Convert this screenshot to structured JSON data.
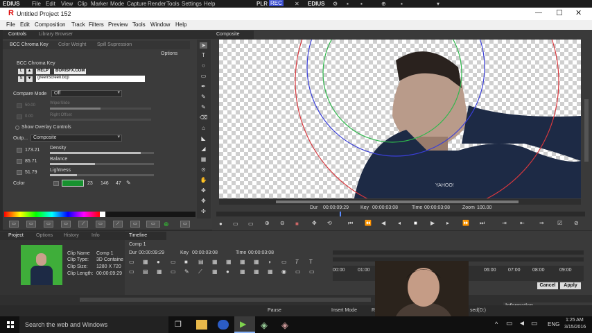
{
  "edius_bar": {
    "logo": "EDIUS",
    "menus": [
      "File",
      "Edit",
      "View",
      "Clip",
      "Marker",
      "Mode",
      "Capture",
      "Render",
      "Tools",
      "Settings",
      "Help"
    ],
    "right_logo": "EDIUS",
    "plr": "PLR",
    "rec": "REC"
  },
  "window": {
    "icon": "R",
    "title": "Untitled Project 152"
  },
  "menu": [
    "File",
    "Edit",
    "Composition",
    "Track",
    "Filters",
    "Preview",
    "Tools",
    "Window",
    "Help"
  ],
  "left_panel": {
    "tabs": [
      "Controls",
      "Library Browser"
    ],
    "subtabs": [
      "BCC Chroma Key",
      "Color Weight",
      "Spill Supression"
    ],
    "options_label": "Options",
    "effect_name": "BCC Chroma Key",
    "help_badge": "HELP",
    "borisfx_badge": "BORISFX.COM",
    "preset_file": "greenScreen.bcp",
    "compare_mode": {
      "label": "Compare Mode",
      "value": "Off"
    },
    "wipe": {
      "value": "50.00",
      "label": "Wipe/Slide",
      "fraction": 0.5
    },
    "right_offset": {
      "value": "0.00",
      "label": "Right Offset",
      "fraction": 0
    },
    "show_overlay": "Show Overlay Controls",
    "output": {
      "label": "Outp...",
      "value": "Composite"
    },
    "params": [
      {
        "value": "173.21",
        "label": "Density",
        "fraction": 0.87
      },
      {
        "value": "85.71",
        "label": "Balance",
        "fraction": 0.43
      },
      {
        "value": "51.79",
        "label": "Lightness",
        "fraction": 0.26
      }
    ],
    "color": {
      "label": "Color",
      "r": "23",
      "g": "146",
      "b": "47",
      "swatch": "#17922f"
    }
  },
  "composite": {
    "tab": "Composite",
    "dur_label": "Dur",
    "dur": "00:00:09:29",
    "key_label": "Key",
    "key": "00:00:03:08",
    "time_label": "Time",
    "time": "00:00:03:08",
    "zoom_label": "Zoom",
    "zoom": "100.00",
    "shirt_text": "YAHOO!"
  },
  "project": {
    "tabs": [
      "Project",
      "Options",
      "History",
      "Info"
    ],
    "clip_name_label": "Clip Name",
    "clip_name": "Comp 1",
    "clip_type_label": "Clip Type:",
    "clip_type": "3D Containe",
    "clip_size_label": "Clip Size:",
    "clip_size": "1280 X 720",
    "clip_length_label": "Clip Length:",
    "clip_length": "00:00:09:29"
  },
  "timeline": {
    "tab": "Timeline",
    "comp": "Comp 1",
    "dur_label": "Dur",
    "dur": "00:00:09:29",
    "key_label": "Key",
    "key": "00:00:03:08",
    "time_label": "Time",
    "time": "00:00:03:08",
    "ruler": [
      "00:00",
      "01:00",
      "06:00",
      "07:00",
      "08:00",
      "09:00"
    ],
    "cancel": "Cancel",
    "apply": "Apply",
    "information": "Information"
  },
  "status": {
    "pause": "Pause",
    "mode": "Insert Mode",
    "r": "R",
    "right": "sed(D:)"
  },
  "taskbar": {
    "search": "Search the web and Windows",
    "lang": "ENG",
    "time": "1:25 AM",
    "date": "3/15/2016"
  },
  "colors": {
    "green": "#17922f",
    "red": "#d8383e",
    "blue": "#3a3fd8",
    "ring_green": "#2fb84c"
  }
}
